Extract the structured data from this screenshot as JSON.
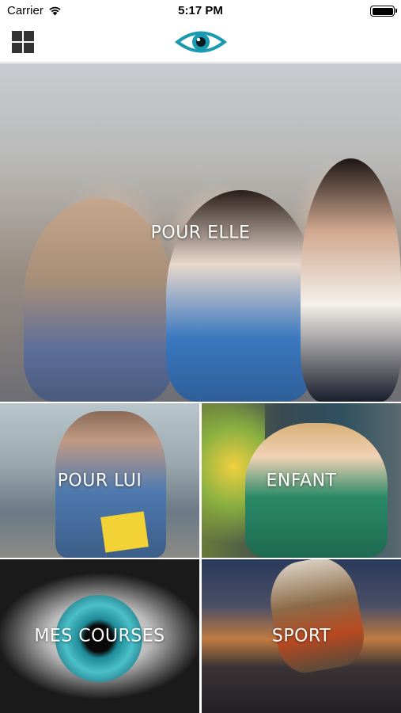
{
  "status_bar": {
    "carrier": "Carrier",
    "time": "5:17 PM",
    "wifi_icon": "wifi-icon",
    "battery_icon": "battery-icon"
  },
  "nav_bar": {
    "menu_icon": "grid-menu-icon",
    "logo_icon": "eye-logo-icon"
  },
  "colors": {
    "logo_teal": "#1a9ab0",
    "label_text": "#ffffff",
    "menu_icon": "#333333"
  },
  "categories": [
    {
      "label": "POUR ELLE"
    },
    {
      "label": "POUR LUI"
    },
    {
      "label": "ENFANT"
    },
    {
      "label": "MES COURSES"
    },
    {
      "label": "SPORT"
    }
  ]
}
